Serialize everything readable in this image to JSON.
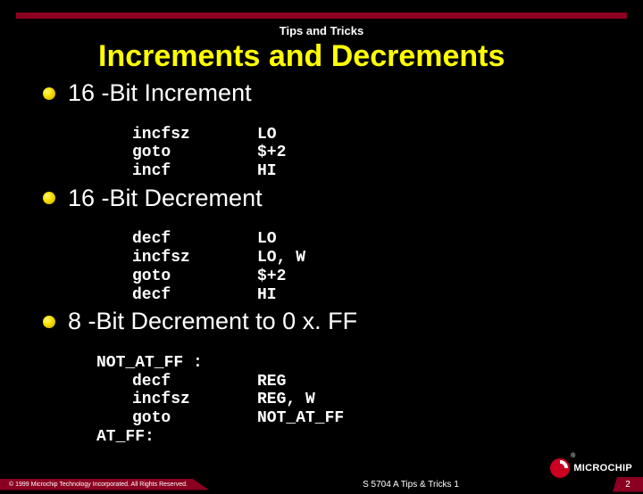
{
  "section_label": "Tips and Tricks",
  "title": "Increments and Decrements",
  "blocks": [
    {
      "heading": "16 -Bit Increment",
      "code": [
        {
          "indent": 40,
          "op": "incfsz",
          "arg": "LO"
        },
        {
          "indent": 40,
          "op": "goto",
          "arg": "$+2"
        },
        {
          "indent": 40,
          "op": "incf",
          "arg": "HI"
        }
      ]
    },
    {
      "heading": "16 -Bit Decrement",
      "code": [
        {
          "indent": 40,
          "op": "decf",
          "arg": "LO"
        },
        {
          "indent": 40,
          "op": "incfsz",
          "arg": "LO, W"
        },
        {
          "indent": 40,
          "op": "goto",
          "arg": "$+2"
        },
        {
          "indent": 40,
          "op": "decf",
          "arg": "HI"
        }
      ]
    },
    {
      "heading": "8 -Bit Decrement to 0 x. FF",
      "code": [
        {
          "indent": 0,
          "label": "NOT_AT_FF :"
        },
        {
          "indent": 40,
          "op": "decf",
          "arg": "REG"
        },
        {
          "indent": 40,
          "op": "incfsz",
          "arg": "REG, W"
        },
        {
          "indent": 40,
          "op": "goto",
          "arg": "NOT_AT_FF"
        },
        {
          "indent": 0,
          "label": "AT_FF:"
        }
      ]
    }
  ],
  "footer": {
    "copyright": "© 1999 Microchip Technology Incorporated. All Rights Reserved.",
    "center": "S 5704 A Tips & Tricks  1",
    "page": "2"
  },
  "logo": {
    "name": "MICROCHIP",
    "reg": "®"
  }
}
